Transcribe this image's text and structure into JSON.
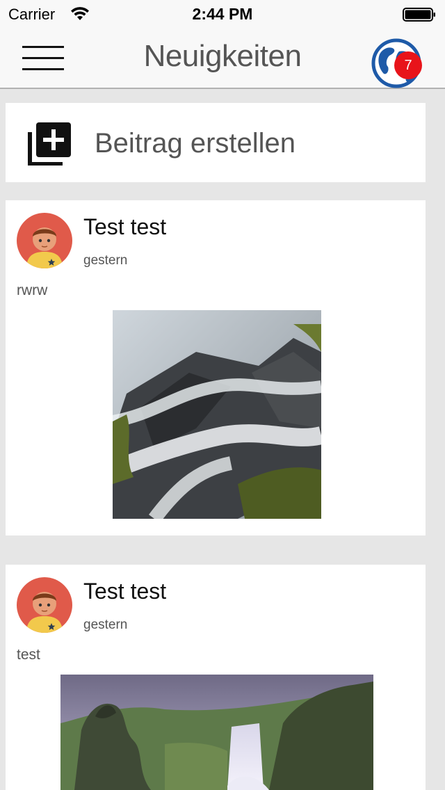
{
  "status_bar": {
    "carrier": "Carrier",
    "time": "2:44 PM"
  },
  "nav": {
    "title": "Neuigkeiten",
    "notification_count": "7",
    "menu_icon": "hamburger-menu-icon",
    "globe_icon": "globe-icon"
  },
  "create_post": {
    "label": "Beitrag erstellen",
    "icon": "add-to-library-icon"
  },
  "posts": [
    {
      "author": "Test test",
      "time": "gestern",
      "text": "rwrw",
      "image": "waterfall-rocks-photo"
    },
    {
      "author": "Test test",
      "time": "gestern",
      "text": "test",
      "image": "waterfall-cliff-photo"
    }
  ],
  "colors": {
    "badge": "#e8141a",
    "globe_blue": "#1e5aa8",
    "avatar_bg": "#e05a4a"
  }
}
